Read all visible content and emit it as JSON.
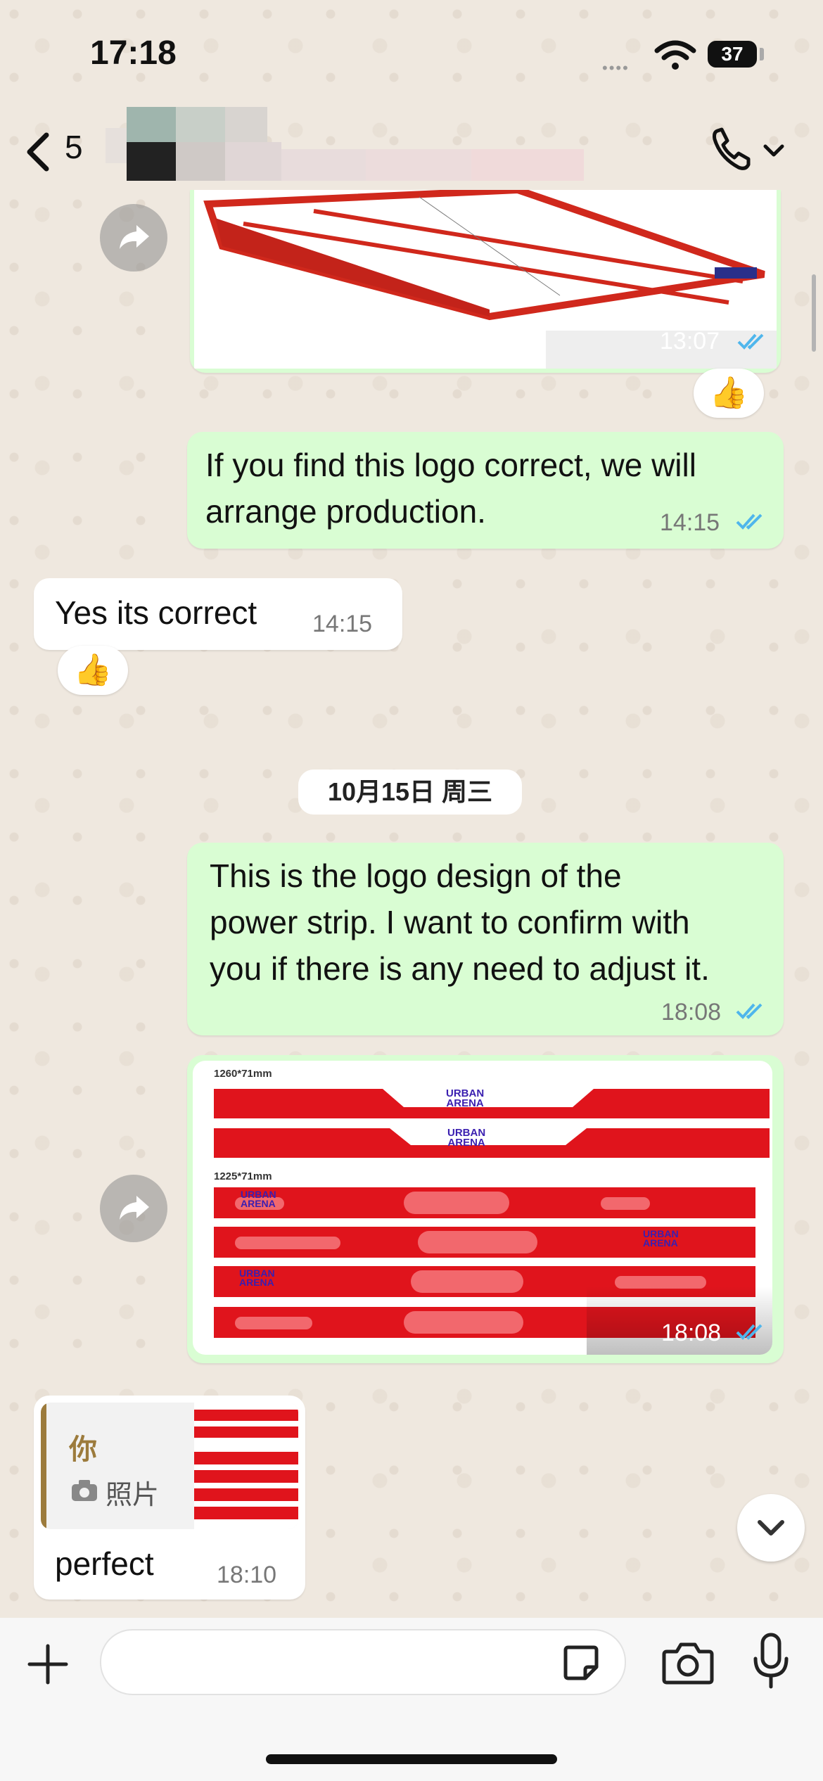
{
  "status_bar": {
    "time": "17:18",
    "battery": "37"
  },
  "header": {
    "unread_count": "5"
  },
  "messages": {
    "m1": {
      "time": "13:07",
      "reaction": "👍"
    },
    "m2": {
      "text_line1": "If you find this logo correct, we will",
      "text_line2": "arrange production.",
      "time": "14:15"
    },
    "m3": {
      "text": "Yes its correct",
      "time": "14:15",
      "reaction": "👍"
    },
    "date_divider": "10月15日 周三",
    "m4": {
      "text_line1": "This is the logo design of the",
      "text_line2": "power strip. I want to confirm with",
      "text_line3": "you if there is any need to adjust it.",
      "time": "18:08"
    },
    "m5": {
      "time": "18:08",
      "label_top": "1260*71mm",
      "label_bottom": "1225*71mm",
      "logo_line1": "URBAN",
      "logo_line2": "ARENA"
    },
    "m6": {
      "quote_author": "你",
      "quote_type": "照片",
      "text": "perfect",
      "time": "18:10"
    }
  },
  "colors": {
    "outgoing_bubble": "#d9fdd3",
    "incoming_bubble": "#ffffff",
    "read_ticks": "#4fb6ec",
    "strip_red": "#e0141c"
  },
  "icons": [
    "back-chevron-icon",
    "phone-icon",
    "chevron-down-icon",
    "forward-icon",
    "double-check-icon",
    "plus-icon",
    "sticker-icon",
    "camera-icon",
    "microphone-icon",
    "camera-small-icon",
    "wifi-icon"
  ]
}
